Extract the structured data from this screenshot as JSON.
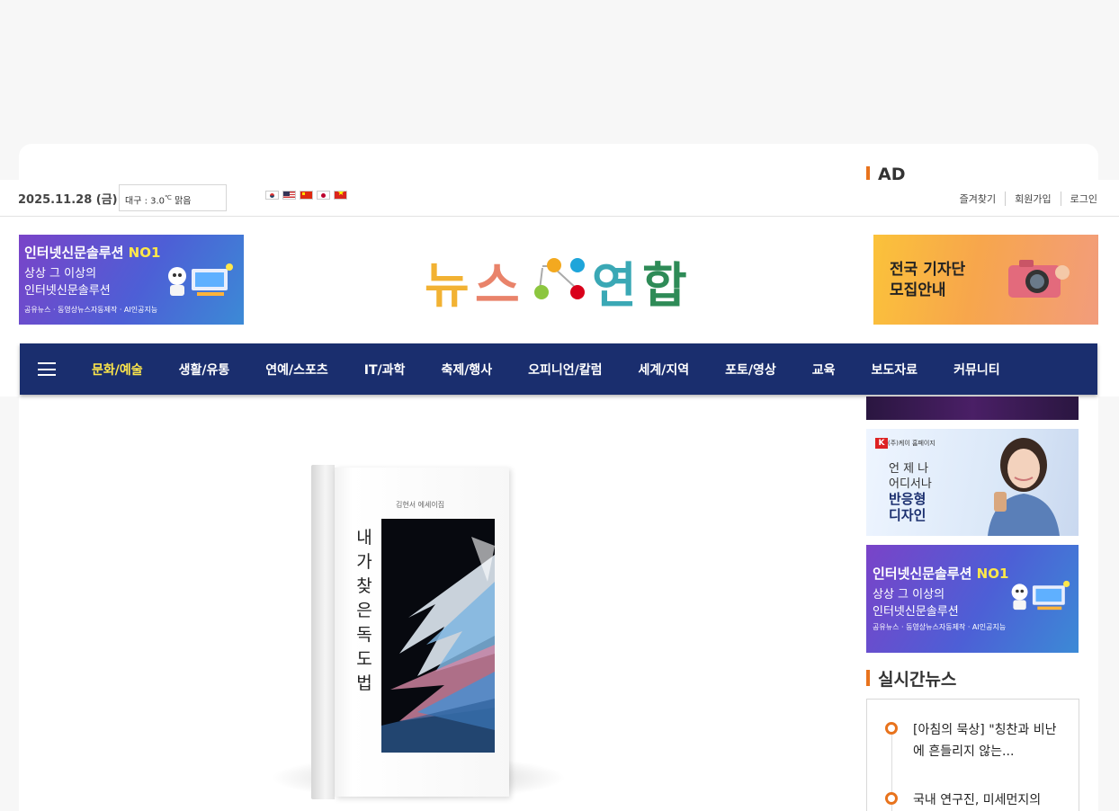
{
  "ad_section": {
    "title": "AD"
  },
  "topbar": {
    "date": "2025.11.28 (금)",
    "weather": "대구 : 3.0",
    "weather_unit": "℃",
    "weather_state": "맑음",
    "links": [
      "즐겨찾기",
      "회원가입",
      "로그인"
    ]
  },
  "header": {
    "logo_text": "뉴스 연합",
    "left_banner": {
      "line1": "인터넷신문솔루션",
      "line1_highlight": "NO1",
      "line2": "상상 그 이상의",
      "line3": "인터넷신문솔루션",
      "line4": "공유뉴스 · 동영상뉴스자동제작 · AI인공지능"
    },
    "right_banner": {
      "line1": "전국 기자단",
      "line2": "모집안내"
    }
  },
  "nav": {
    "items": [
      "문화/예술",
      "생활/유통",
      "연예/스포츠",
      "IT/과학",
      "축제/행사",
      "오피니언/칼럼",
      "세계/지역",
      "포토/영상",
      "교육",
      "보도자료",
      "커뮤니티"
    ],
    "active_index": 0
  },
  "article": {
    "book_title": "내가 찾은 독도법",
    "book_author": "김현서 에세이집"
  },
  "sidebar": {
    "ad1": {
      "brand": "(주)케이 홈페이지",
      "line1": "언 제 나",
      "line2": "어디서나",
      "line3": "반응형",
      "line4": "디자인"
    },
    "ad2": {
      "line1": "인터넷신문솔루션",
      "line1_highlight": "NO1",
      "line2": "상상 그 이상의",
      "line3": "인터넷신문솔루션",
      "line4": "공유뉴스 · 동영상뉴스자동제작 · AI인공지능"
    },
    "realtime_title": "실시간뉴스",
    "realtime_items": [
      "[아침의 묵상] \"칭찬과 비난에 흔들리지 않는...",
      "국내 연구진, 미세먼지의"
    ]
  },
  "colors": {
    "nav_bg": "#1a2e6e",
    "nav_active": "#ffe74a",
    "accent": "#e8731d"
  }
}
